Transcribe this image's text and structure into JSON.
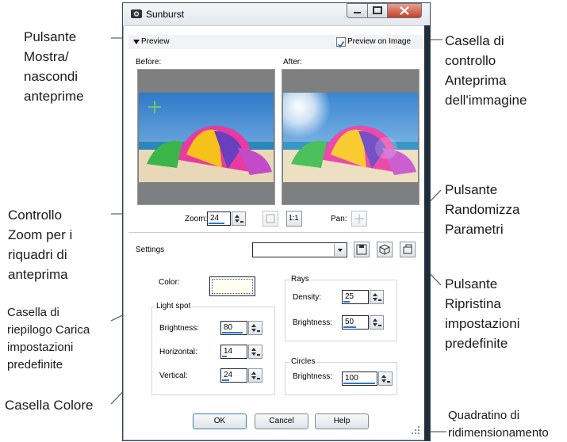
{
  "window": {
    "title": "Sunburst",
    "preview_toggle_label": "Preview",
    "preview_on_image_label": "Preview on Image",
    "preview_on_image_checked": true,
    "before_label": "Before:",
    "after_label": "After:",
    "zoom_label": "Zoom:",
    "zoom_value": "24",
    "zoom_fit_label": "1:1",
    "pan_label": "Pan:",
    "settings_label": "Settings",
    "settings_value": "",
    "color_label": "Color:",
    "light_spot": {
      "group_label": "Light spot",
      "brightness_label": "Brightness:",
      "brightness_value": "80",
      "horizontal_label": "Horizontal:",
      "horizontal_value": "14",
      "vertical_label": "Vertical:",
      "vertical_value": "24"
    },
    "rays": {
      "group_label": "Rays",
      "density_label": "Density:",
      "density_value": "25",
      "brightness_label": "Brightness:",
      "brightness_value": "50"
    },
    "circles": {
      "group_label": "Circles",
      "brightness_label": "Brightness:",
      "brightness_value": "100"
    },
    "buttons": {
      "ok": "OK",
      "cancel": "Cancel",
      "help": "Help"
    }
  },
  "callouts": {
    "show_hide": [
      "Pulsante",
      "Mostra/",
      "nascondi",
      "anteprime"
    ],
    "preview_checkbox": [
      "Casella di",
      "controllo",
      "Anteprima",
      "dell'immagine"
    ],
    "zoom_control": [
      "Controllo",
      "Zoom per i",
      "riquadri di",
      "anteprima"
    ],
    "randomize": [
      "Pulsante",
      "Randomizza",
      "Parametri"
    ],
    "reset": [
      "Pulsante",
      "Ripristina",
      "impostazioni",
      "predefinite"
    ],
    "load_presets": [
      "Casella di",
      "riepilogo Carica",
      "impostazioni",
      "predefinite"
    ],
    "color_box": [
      "Casella Colore"
    ],
    "resize_grip": [
      "Quadratino di",
      "ridimensionamento"
    ]
  },
  "colors": {
    "window_border": "#3a4552",
    "close_button": "#c3412a",
    "progress_blue": "#2f74d6"
  }
}
